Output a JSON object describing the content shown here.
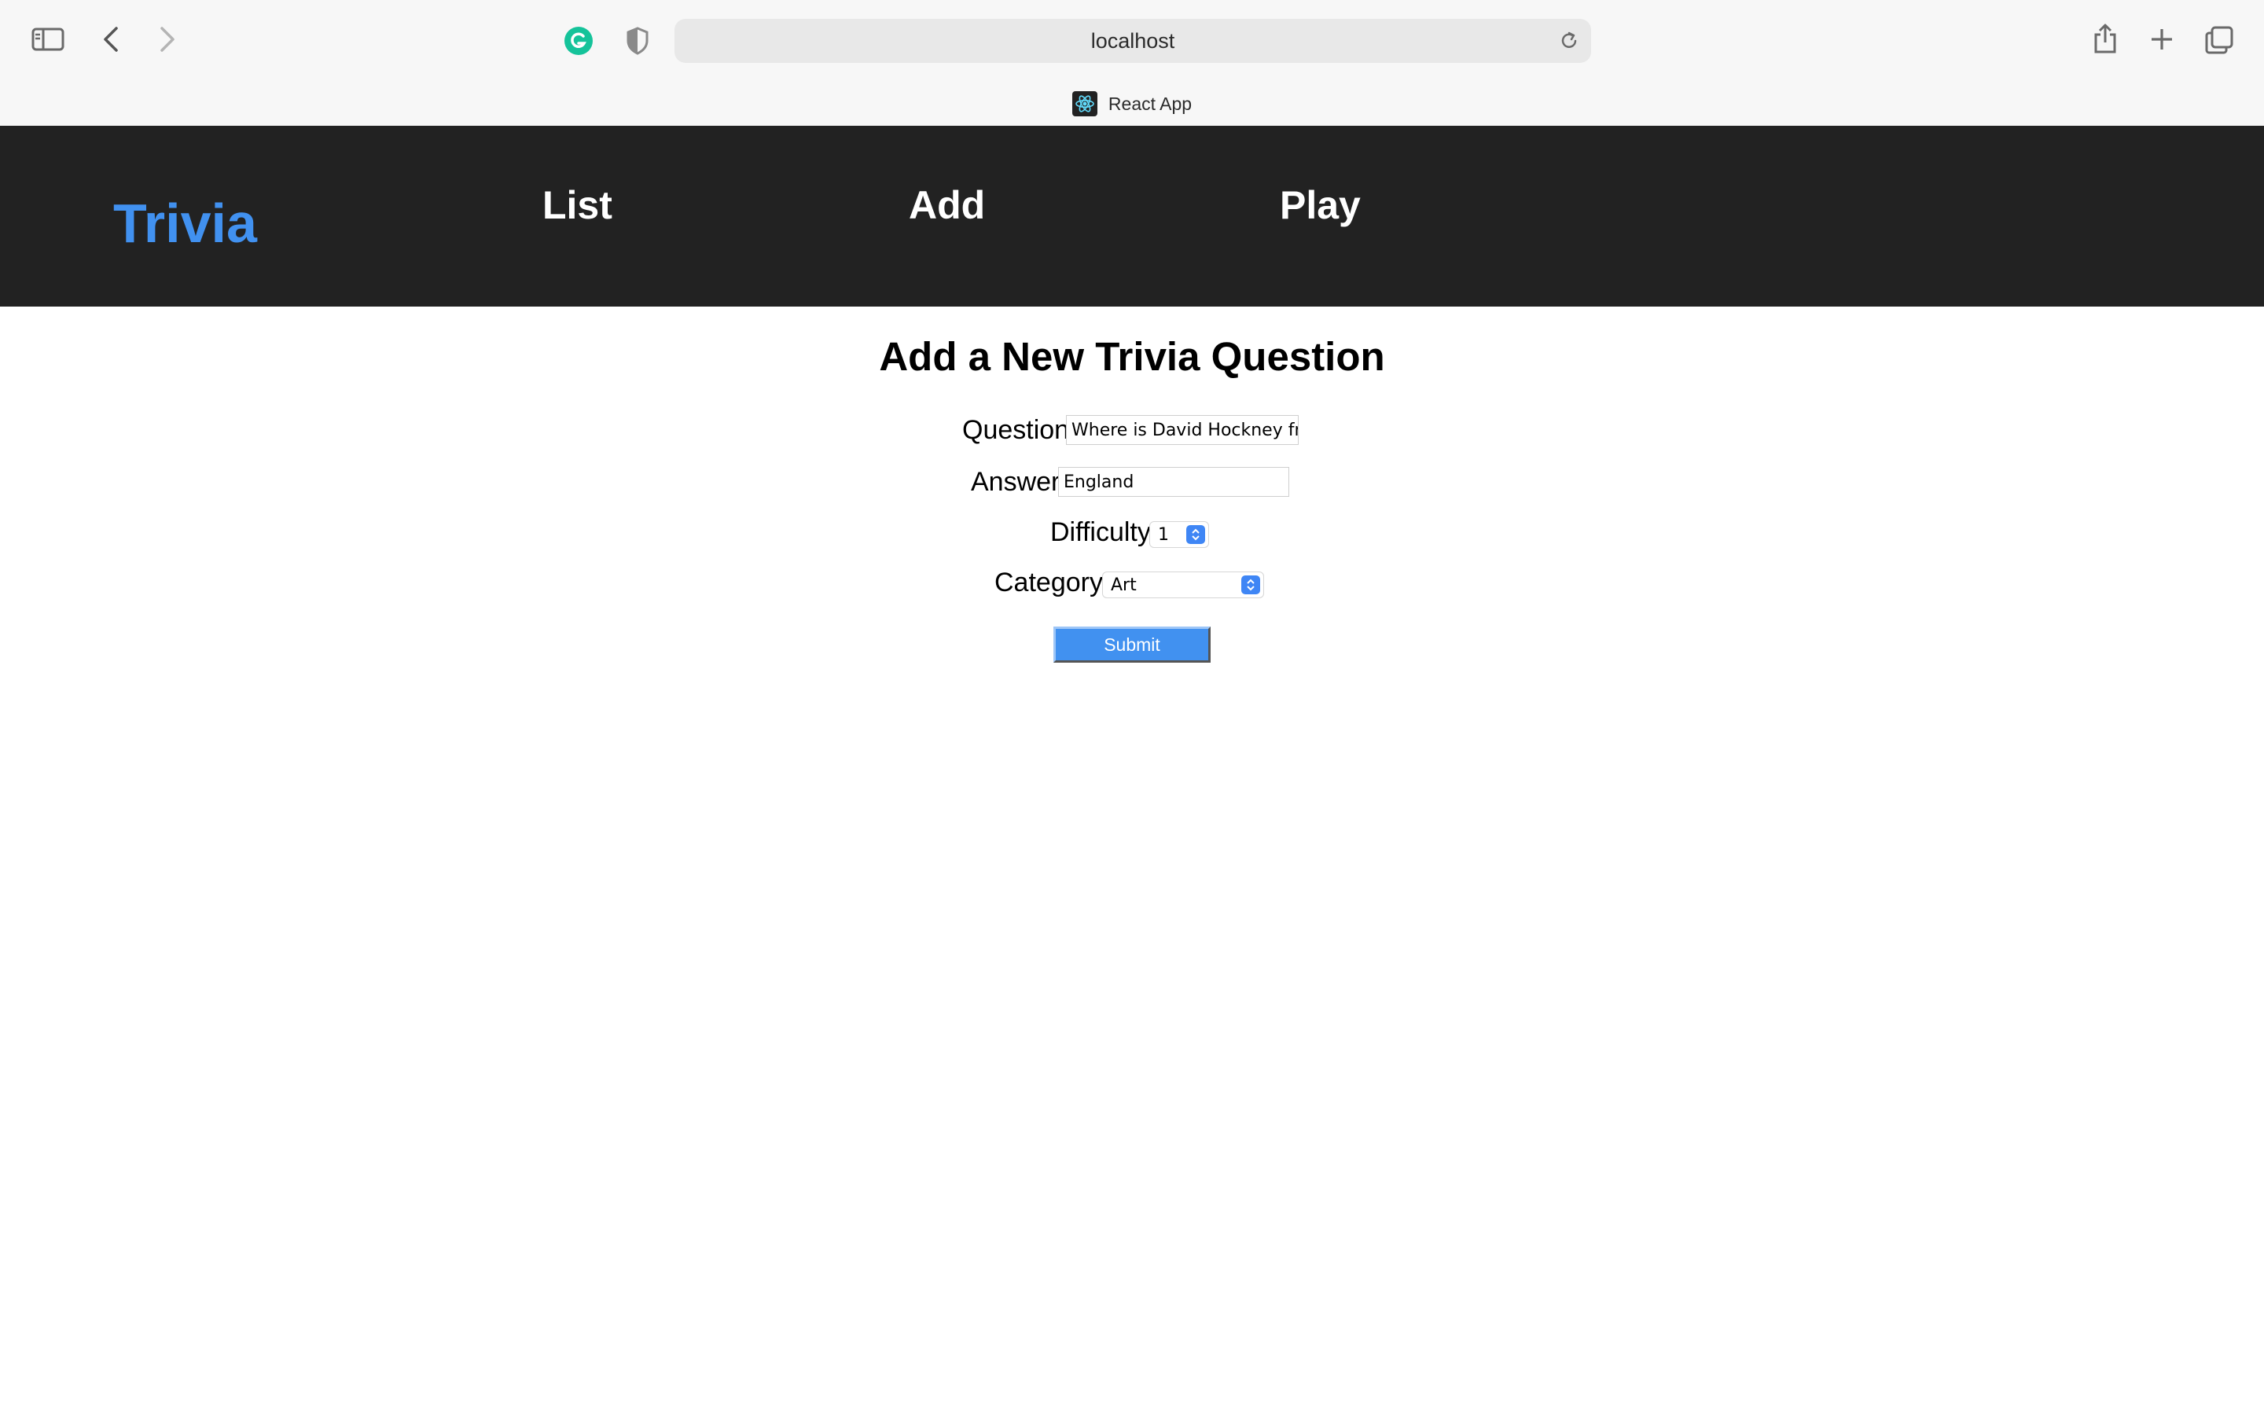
{
  "browser": {
    "url": "localhost",
    "tab_title": "React App",
    "icons": [
      "sidebar-icon",
      "back-icon",
      "forward-icon",
      "grammarly-icon",
      "shield-icon",
      "reload-icon",
      "share-icon",
      "new-tab-icon",
      "tabs-overview-icon",
      "react-icon"
    ]
  },
  "header": {
    "brand": "Trivia",
    "nav": {
      "list": "List",
      "add": "Add",
      "play": "Play"
    },
    "colors": {
      "background": "#222222",
      "brand": "#4191f0",
      "nav": "#ffffff"
    }
  },
  "form": {
    "title": "Add a New Trivia Question",
    "question_label": "Question",
    "question_value": "Where is David Hockney from?",
    "answer_label": "Answer",
    "answer_value": "England",
    "difficulty_label": "Difficulty",
    "difficulty_value": "1",
    "category_label": "Category",
    "category_value": "Art",
    "submit_label": "Submit",
    "colors": {
      "submit": "#4191f0",
      "select_accent": "#3f86f5"
    }
  }
}
